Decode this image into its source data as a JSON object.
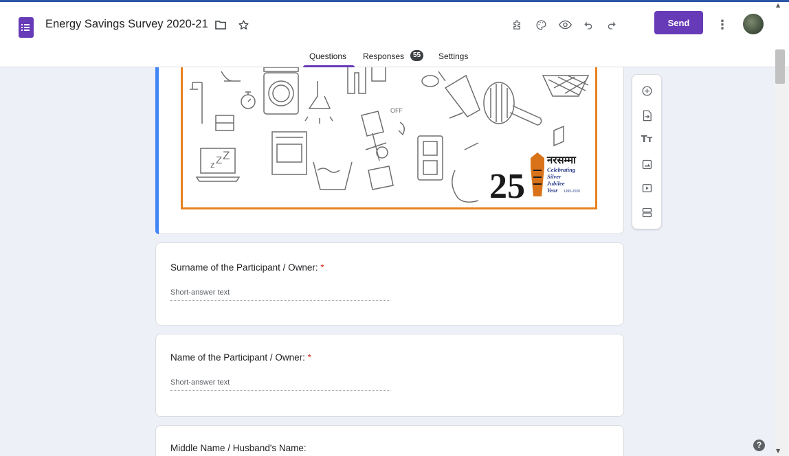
{
  "app": {
    "title": "Energy Savings Survey 2020-21",
    "accent_color": "#673ab7",
    "icons": [
      "folder-icon",
      "star-icon",
      "addon-icon",
      "palette-icon",
      "preview-eye-icon",
      "undo-icon",
      "redo-icon",
      "more-vert-icon"
    ]
  },
  "header": {
    "send_label": "Send",
    "tabs": [
      {
        "label": "Questions",
        "active": true
      },
      {
        "label": "Responses",
        "badge": "55"
      },
      {
        "label": "Settings"
      }
    ]
  },
  "banner": {
    "logo_number": "25",
    "logo_devanagari": "नरसम्मा",
    "logo_lines": [
      "Celebrating",
      "Silver",
      "Jubilee",
      "Year"
    ],
    "logo_years": "1995-2020",
    "off_label": "OFF",
    "border_color": "#e8821e"
  },
  "questions": [
    {
      "title": "Surname of the Participant / Owner:",
      "required": "*",
      "placeholder": "Short-answer text"
    },
    {
      "title": "Name of the Participant / Owner:",
      "required": "*",
      "placeholder": "Short-answer text"
    },
    {
      "title": "Middle Name / Husband's Name:"
    }
  ],
  "toolbar": {
    "icons": [
      "add-question-icon",
      "import-questions-icon",
      "add-title-icon",
      "add-image-icon",
      "add-video-icon",
      "add-section-icon"
    ]
  }
}
